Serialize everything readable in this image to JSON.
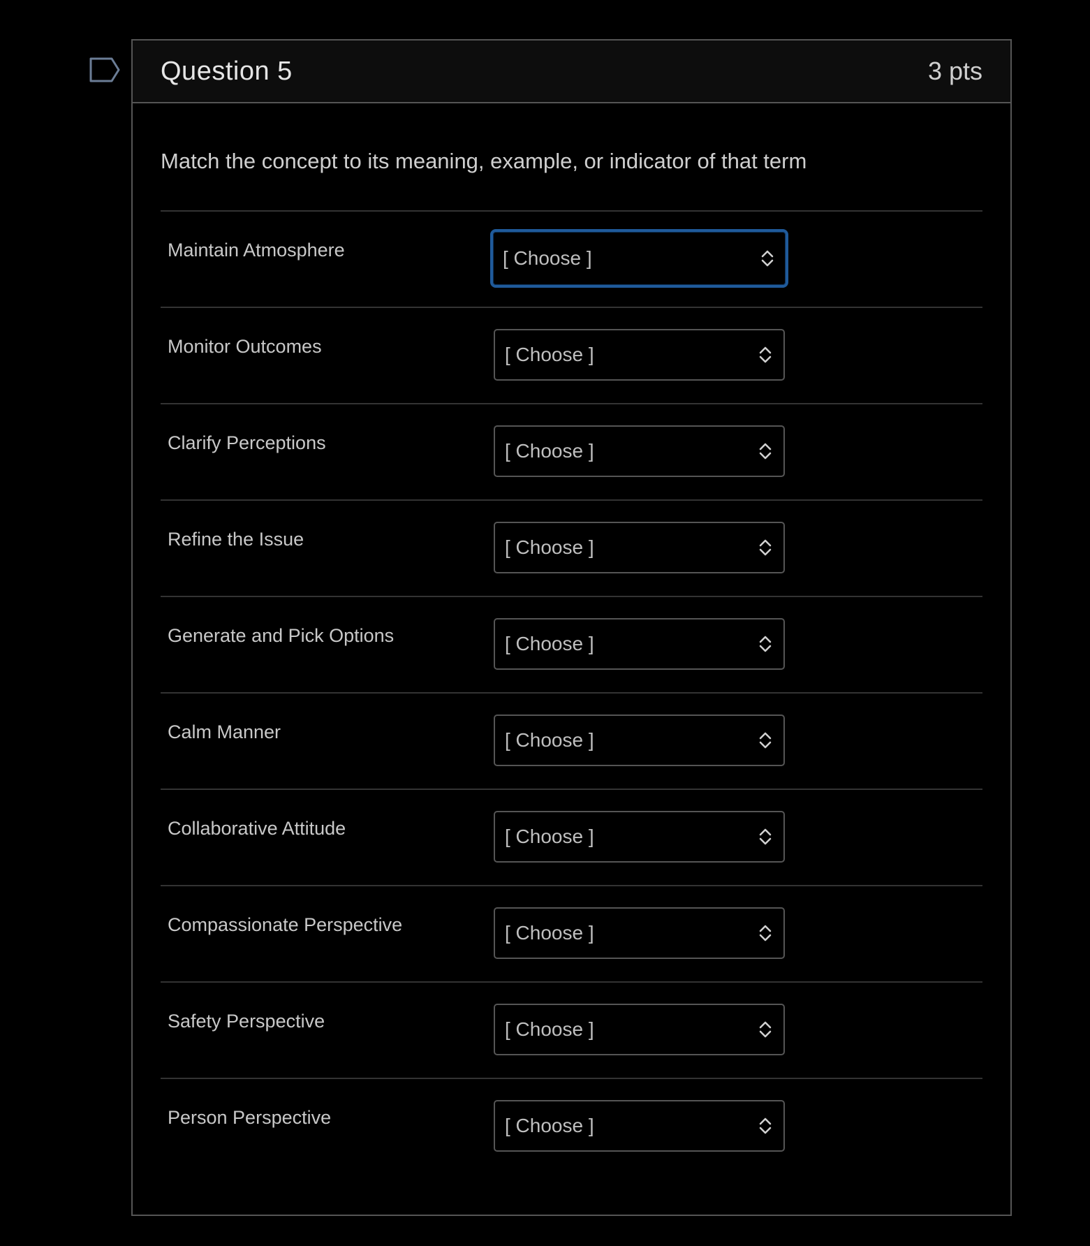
{
  "question": {
    "title": "Question 5",
    "points": "3 pts",
    "prompt": "Match the concept to its meaning, example, or indicator of that term"
  },
  "matches": [
    {
      "label": "Maintain Atmosphere",
      "selected": "[ Choose ]",
      "focused": true
    },
    {
      "label": "Monitor Outcomes",
      "selected": "[ Choose ]",
      "focused": false
    },
    {
      "label": "Clarify Perceptions",
      "selected": "[ Choose ]",
      "focused": false
    },
    {
      "label": "Refine the Issue",
      "selected": "[ Choose ]",
      "focused": false
    },
    {
      "label": "Generate and Pick Options",
      "selected": "[ Choose ]",
      "focused": false
    },
    {
      "label": "Calm Manner",
      "selected": "[ Choose ]",
      "focused": false
    },
    {
      "label": "Collaborative Attitude",
      "selected": "[ Choose ]",
      "focused": false
    },
    {
      "label": "Compassionate Perspective",
      "selected": "[ Choose ]",
      "focused": false
    },
    {
      "label": "Safety Perspective",
      "selected": "[ Choose ]",
      "focused": false
    },
    {
      "label": "Person Perspective",
      "selected": "[ Choose ]",
      "focused": false
    }
  ],
  "icons": {
    "flag": "bookmark-flag-icon",
    "select_arrows": "chevron-up-down-icon"
  },
  "colors": {
    "background": "#000000",
    "focus_ring": "#1f5a9a",
    "border": "#555555"
  }
}
